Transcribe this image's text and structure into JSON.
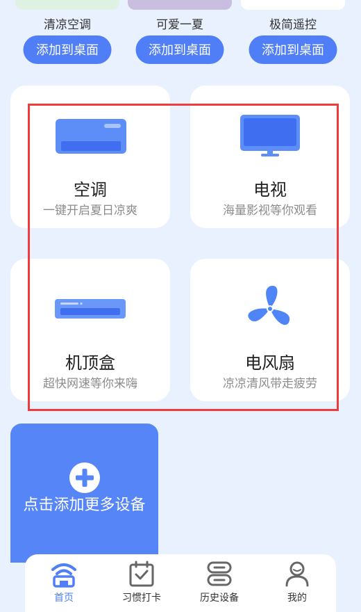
{
  "themes": [
    {
      "name": "清凉空调",
      "button": "添加到桌面",
      "color": "#dff1e2"
    },
    {
      "name": "可爱一夏",
      "button": "添加到桌面",
      "color": "#c9bde0"
    },
    {
      "name": "极简遥控",
      "button": "添加到桌面",
      "color": "#ffffff"
    }
  ],
  "devices": [
    {
      "title": "空调",
      "subtitle": "一键开启夏日凉爽",
      "icon": "air-conditioner-icon"
    },
    {
      "title": "电视",
      "subtitle": "海量影视等你观看",
      "icon": "tv-icon"
    },
    {
      "title": "机顶盒",
      "subtitle": "超快网速等你来嗨",
      "icon": "set-top-box-icon"
    },
    {
      "title": "电风扇",
      "subtitle": "凉凉清风带走疲劳",
      "icon": "fan-icon"
    }
  ],
  "add_more": {
    "label": "点击添加更多设备",
    "icon": "plus-circle-icon"
  },
  "tabbar": {
    "items": [
      {
        "label": "首页",
        "icon": "home-signal-icon",
        "active": true
      },
      {
        "label": "习惯打卡",
        "icon": "calendar-check-icon",
        "active": false
      },
      {
        "label": "历史设备",
        "icon": "device-stack-icon",
        "active": false
      },
      {
        "label": "我的",
        "icon": "user-icon",
        "active": false
      }
    ]
  },
  "colors": {
    "accent": "#4f7ef7",
    "highlight": "#ee3b3b",
    "background": "#e8f1fd"
  }
}
